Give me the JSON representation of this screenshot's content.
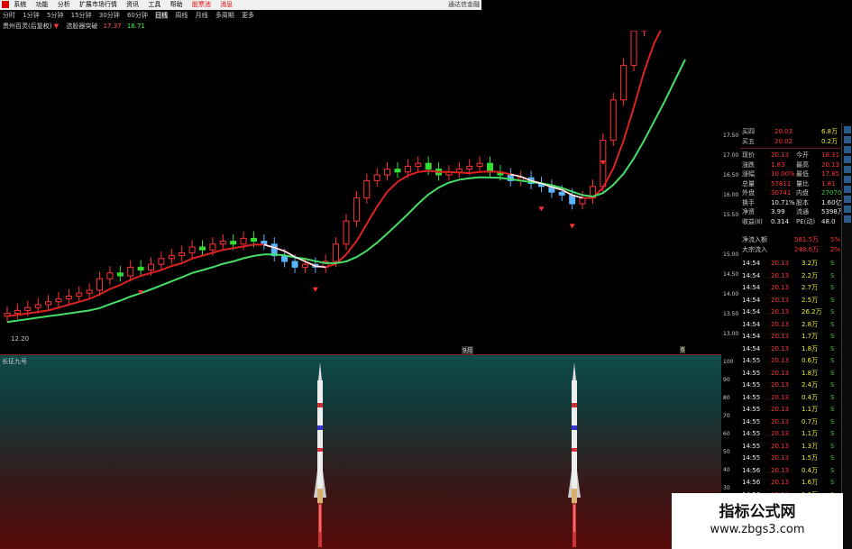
{
  "menu": {
    "items": [
      "系统",
      "功能",
      "分析",
      "扩展市场行情",
      "资讯",
      "工具",
      "帮助",
      "股票池",
      "消息"
    ],
    "window_title": "通达信金融"
  },
  "periods": [
    "分时",
    "1分钟",
    "5分钟",
    "15分钟",
    "30分钟",
    "60分钟",
    "日线",
    "周线",
    "月线",
    "多周期",
    "更多"
  ],
  "period_selected": 6,
  "info_bar": {
    "title": "贵州百灵(后复权)",
    "indicator": "选股器突破",
    "value1": "17.37",
    "value2": "16.71"
  },
  "x_axis": {
    "start_price": "12.20",
    "marks": [
      "9月",
      "6"
    ]
  },
  "price_axis": [
    "17.50",
    "17.00",
    "16.50",
    "16.00",
    "15.50",
    "15.00",
    "14.50",
    "14.00",
    "13.50",
    "13.00"
  ],
  "sub_panel": {
    "title": "长征九号"
  },
  "sub_axis": [
    "100",
    "90",
    "80",
    "70",
    "60",
    "50",
    "40",
    "30",
    "20",
    "10"
  ],
  "quote": {
    "order_book": [
      {
        "label": "买四",
        "price": "20.03",
        "vol": "6.8万"
      },
      {
        "label": "买五",
        "price": "20.02",
        "vol": "0.2万"
      }
    ],
    "stats": [
      {
        "l1": "现价",
        "v1": "20.13",
        "l2": "今开",
        "v2": "18.31"
      },
      {
        "l1": "涨跌",
        "v1": "1.83",
        "l2": "最高",
        "v2": "20.13"
      },
      {
        "l1": "涨幅",
        "v1": "10.00%",
        "l2": "最低",
        "v2": "17.85"
      },
      {
        "l1": "总量",
        "v1": "57811",
        "l2": "量比",
        "v2": "1.81"
      },
      {
        "l1": "外盘",
        "v1": "30741",
        "l2": "内盘",
        "v2": "27070"
      },
      {
        "l1": "换手",
        "v1": "10.71%",
        "l2": "股本",
        "v2": "1.60亿"
      },
      {
        "l1": "净资",
        "v1": "3.99",
        "l2": "流通",
        "v2": "5398万"
      },
      {
        "l1": "收益(Ⅱ)",
        "v1": "0.314",
        "l2": "PE(动)",
        "v2": "48.0"
      }
    ],
    "flows": [
      {
        "l": "净流入额",
        "v": "581.5万",
        "p": "5%"
      },
      {
        "l": "大宗流入",
        "v": "248.6万",
        "p": "2%"
      }
    ],
    "ticks": [
      {
        "t": "14:54",
        "p": "20.13",
        "v": "3.2万",
        "s": "S"
      },
      {
        "t": "14:54",
        "p": "20.13",
        "v": "2.2万",
        "s": "S"
      },
      {
        "t": "14:54",
        "p": "20.13",
        "v": "2.7万",
        "s": "S"
      },
      {
        "t": "14:54",
        "p": "20.13",
        "v": "2.5万",
        "s": "S"
      },
      {
        "t": "14:54",
        "p": "20.13",
        "v": "26.2万",
        "s": "S"
      },
      {
        "t": "14:54",
        "p": "20.13",
        "v": "2.8万",
        "s": "S"
      },
      {
        "t": "14:54",
        "p": "20.13",
        "v": "1.7万",
        "s": "S"
      },
      {
        "t": "14:54",
        "p": "20.13",
        "v": "1.8万",
        "s": "S"
      },
      {
        "t": "14:55",
        "p": "20.13",
        "v": "0.6万",
        "s": "S"
      },
      {
        "t": "14:55",
        "p": "20.13",
        "v": "1.8万",
        "s": "S"
      },
      {
        "t": "14:55",
        "p": "20.13",
        "v": "2.4万",
        "s": "S"
      },
      {
        "t": "14:55",
        "p": "20.13",
        "v": "0.4万",
        "s": "S"
      },
      {
        "t": "14:55",
        "p": "20.13",
        "v": "1.1万",
        "s": "S"
      },
      {
        "t": "14:55",
        "p": "20.13",
        "v": "0.7万",
        "s": "S"
      },
      {
        "t": "14:55",
        "p": "20.13",
        "v": "1.1万",
        "s": "S"
      },
      {
        "t": "14:55",
        "p": "20.13",
        "v": "1.3万",
        "s": "S"
      },
      {
        "t": "14:55",
        "p": "20.13",
        "v": "1.5万",
        "s": "S"
      },
      {
        "t": "14:56",
        "p": "20.13",
        "v": "0.4万",
        "s": "S"
      },
      {
        "t": "14:56",
        "p": "20.13",
        "v": "1.6万",
        "s": "S"
      },
      {
        "t": "14:56",
        "p": "20.13",
        "v": "1.0万",
        "s": "S"
      },
      {
        "t": "14:56",
        "p": "20.13",
        "v": "1.5万",
        "s": "S"
      },
      {
        "t": "14:56",
        "p": "20.13",
        "v": "0.4万",
        "s": "S"
      },
      {
        "t": "14:56",
        "p": "20.13",
        "v": "0.6万",
        "s": "S"
      }
    ]
  },
  "watermark": {
    "line1": "指标公式网",
    "line2": "www.zbgs3.com"
  },
  "colors": {
    "up": "#ff3333",
    "down": "#33cc33",
    "ma_red": "#dd2222",
    "ma_green": "#44dd66"
  }
}
